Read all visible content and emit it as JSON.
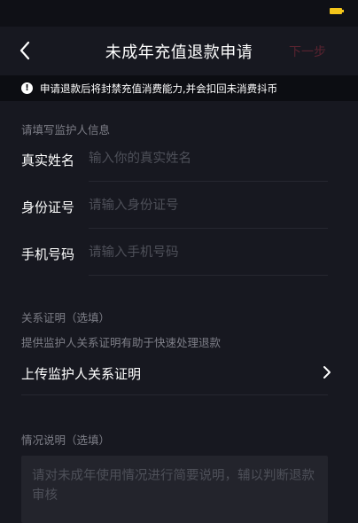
{
  "status_bar": {
    "battery_color": "#f3c51a"
  },
  "nav": {
    "title": "未成年充值退款申请",
    "next_label": "下一步",
    "next_color": "#5a2330",
    "back_icon": "chevron-left-icon"
  },
  "notice": {
    "icon": "exclamation-circle-icon",
    "text": "申请退款后将封禁充值消费能力,并会扣回未消费抖币"
  },
  "guardian": {
    "section_label": "请填写监护人信息",
    "fields": [
      {
        "label": "真实姓名",
        "value": "",
        "placeholder": "输入你的真实姓名"
      },
      {
        "label": "身份证号",
        "value": "",
        "placeholder": "请输入身份证号"
      },
      {
        "label": "手机号码",
        "value": "",
        "placeholder": "请输入手机号码"
      }
    ]
  },
  "relationship": {
    "section_label": "关系证明（选填）",
    "hint": "提供监护人关系证明有助于快速处理退款",
    "upload_label": "上传监护人关系证明",
    "chevron_icon": "chevron-right-icon"
  },
  "situation": {
    "section_label": "情况说明（选填）",
    "value": "",
    "placeholder": "请对未成年使用情况进行简要说明，辅以判断退款审核"
  }
}
